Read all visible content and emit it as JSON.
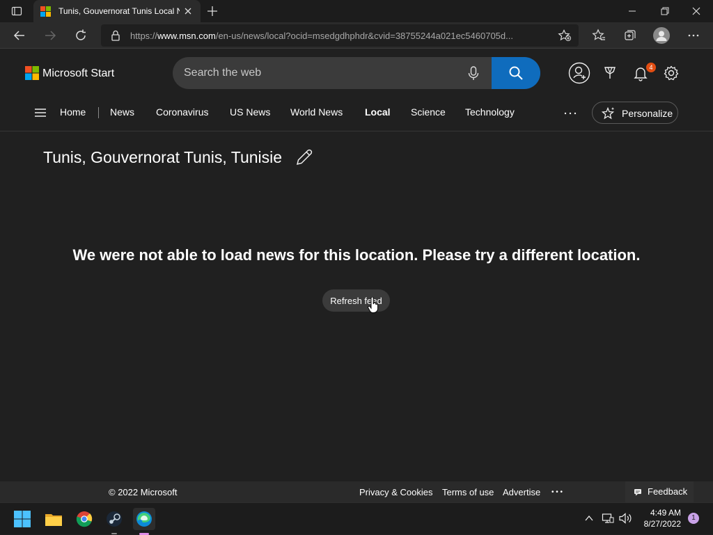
{
  "browser": {
    "tab_title": "Tunis, Gouvernorat Tunis Local News",
    "url_host": "https://www.msn.com",
    "url_rest": "/en-us/news/local?ocid=msedgdhphdr&cvid=38755244a021ec5460705d...",
    "url_prefix": "https://",
    "url_domain": "www.msn.com"
  },
  "header": {
    "logo_text": "Microsoft Start",
    "search_placeholder": "Search the web",
    "notification_count": "4"
  },
  "nav": {
    "items": [
      {
        "label": "Home"
      },
      {
        "label": "News"
      },
      {
        "label": "Coronavirus"
      },
      {
        "label": "US News"
      },
      {
        "label": "World News"
      },
      {
        "label": "Local"
      },
      {
        "label": "Science"
      },
      {
        "label": "Technology"
      }
    ],
    "personalize_label": "Personalize"
  },
  "main": {
    "location": "Tunis, Gouvernorat Tunis, Tunisie",
    "message": "We were not able to load news for this location. Please try a different location.",
    "refresh_label": "Refresh feed"
  },
  "footer": {
    "copyright": "© 2022 Microsoft",
    "links": [
      "Privacy & Cookies",
      "Terms of use",
      "Advertise"
    ],
    "more": "• • •",
    "feedback_label": "Feedback"
  },
  "taskbar": {
    "time": "4:49 AM",
    "date": "8/27/2022",
    "notification_badge": "1"
  },
  "colors": {
    "accent": "#0f6cbd",
    "background": "#202020",
    "badge": "#e24d12"
  }
}
